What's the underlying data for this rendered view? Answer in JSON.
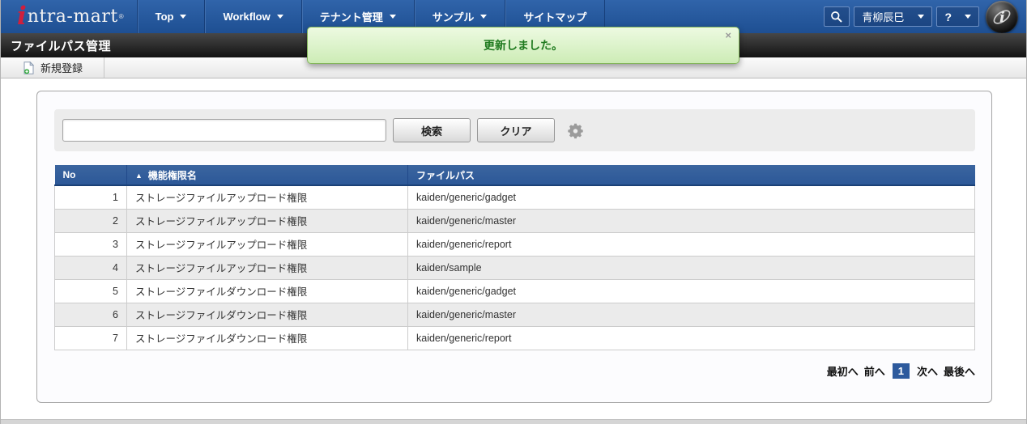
{
  "header": {
    "logo": {
      "i": "i",
      "text": "ntra-mart",
      "reg": "®"
    },
    "menus": [
      {
        "label": "Top",
        "has_dropdown": true
      },
      {
        "label": "Workflow",
        "has_dropdown": true
      },
      {
        "label": "テナント管理",
        "has_dropdown": true
      },
      {
        "label": "サンプル",
        "has_dropdown": true
      },
      {
        "label": "サイトマップ",
        "has_dropdown": false
      }
    ],
    "user_name": "青柳辰巳",
    "help_label": "?"
  },
  "page": {
    "title": "ファイルパス管理"
  },
  "toolbar": {
    "new_label": "新規登録"
  },
  "toast": {
    "message": "更新しました。",
    "close_label": "×"
  },
  "search": {
    "input_value": "",
    "search_label": "検索",
    "clear_label": "クリア"
  },
  "table": {
    "sort_indicator": "▲",
    "columns": [
      "No",
      "機能権限名",
      "ファイルパス"
    ],
    "rows": [
      {
        "no": "1",
        "permission": "ストレージファイルアップロード権限",
        "path": "kaiden/generic/gadget"
      },
      {
        "no": "2",
        "permission": "ストレージファイルアップロード権限",
        "path": "kaiden/generic/master"
      },
      {
        "no": "3",
        "permission": "ストレージファイルアップロード権限",
        "path": "kaiden/generic/report"
      },
      {
        "no": "4",
        "permission": "ストレージファイルアップロード権限",
        "path": "kaiden/sample"
      },
      {
        "no": "5",
        "permission": "ストレージファイルダウンロード権限",
        "path": "kaiden/generic/gadget"
      },
      {
        "no": "6",
        "permission": "ストレージファイルダウンロード権限",
        "path": "kaiden/generic/master"
      },
      {
        "no": "7",
        "permission": "ストレージファイルダウンロード権限",
        "path": "kaiden/generic/report"
      }
    ]
  },
  "pagination": {
    "first": "最初へ",
    "prev": "前へ",
    "current": "1",
    "next": "次へ",
    "last": "最後へ"
  },
  "colors": {
    "nav_blue_top": "#3064aa",
    "nav_blue_bottom": "#1e4f92",
    "titlebar_dark": "#131313",
    "table_header_blue": "#31599c",
    "success_text_green": "#1f7a1f",
    "toast_bg_green": "#dff3c9",
    "toast_border_green": "#82b55a",
    "current_page_blue": "#2d5a9d",
    "logo_red": "#cf1f3c"
  }
}
